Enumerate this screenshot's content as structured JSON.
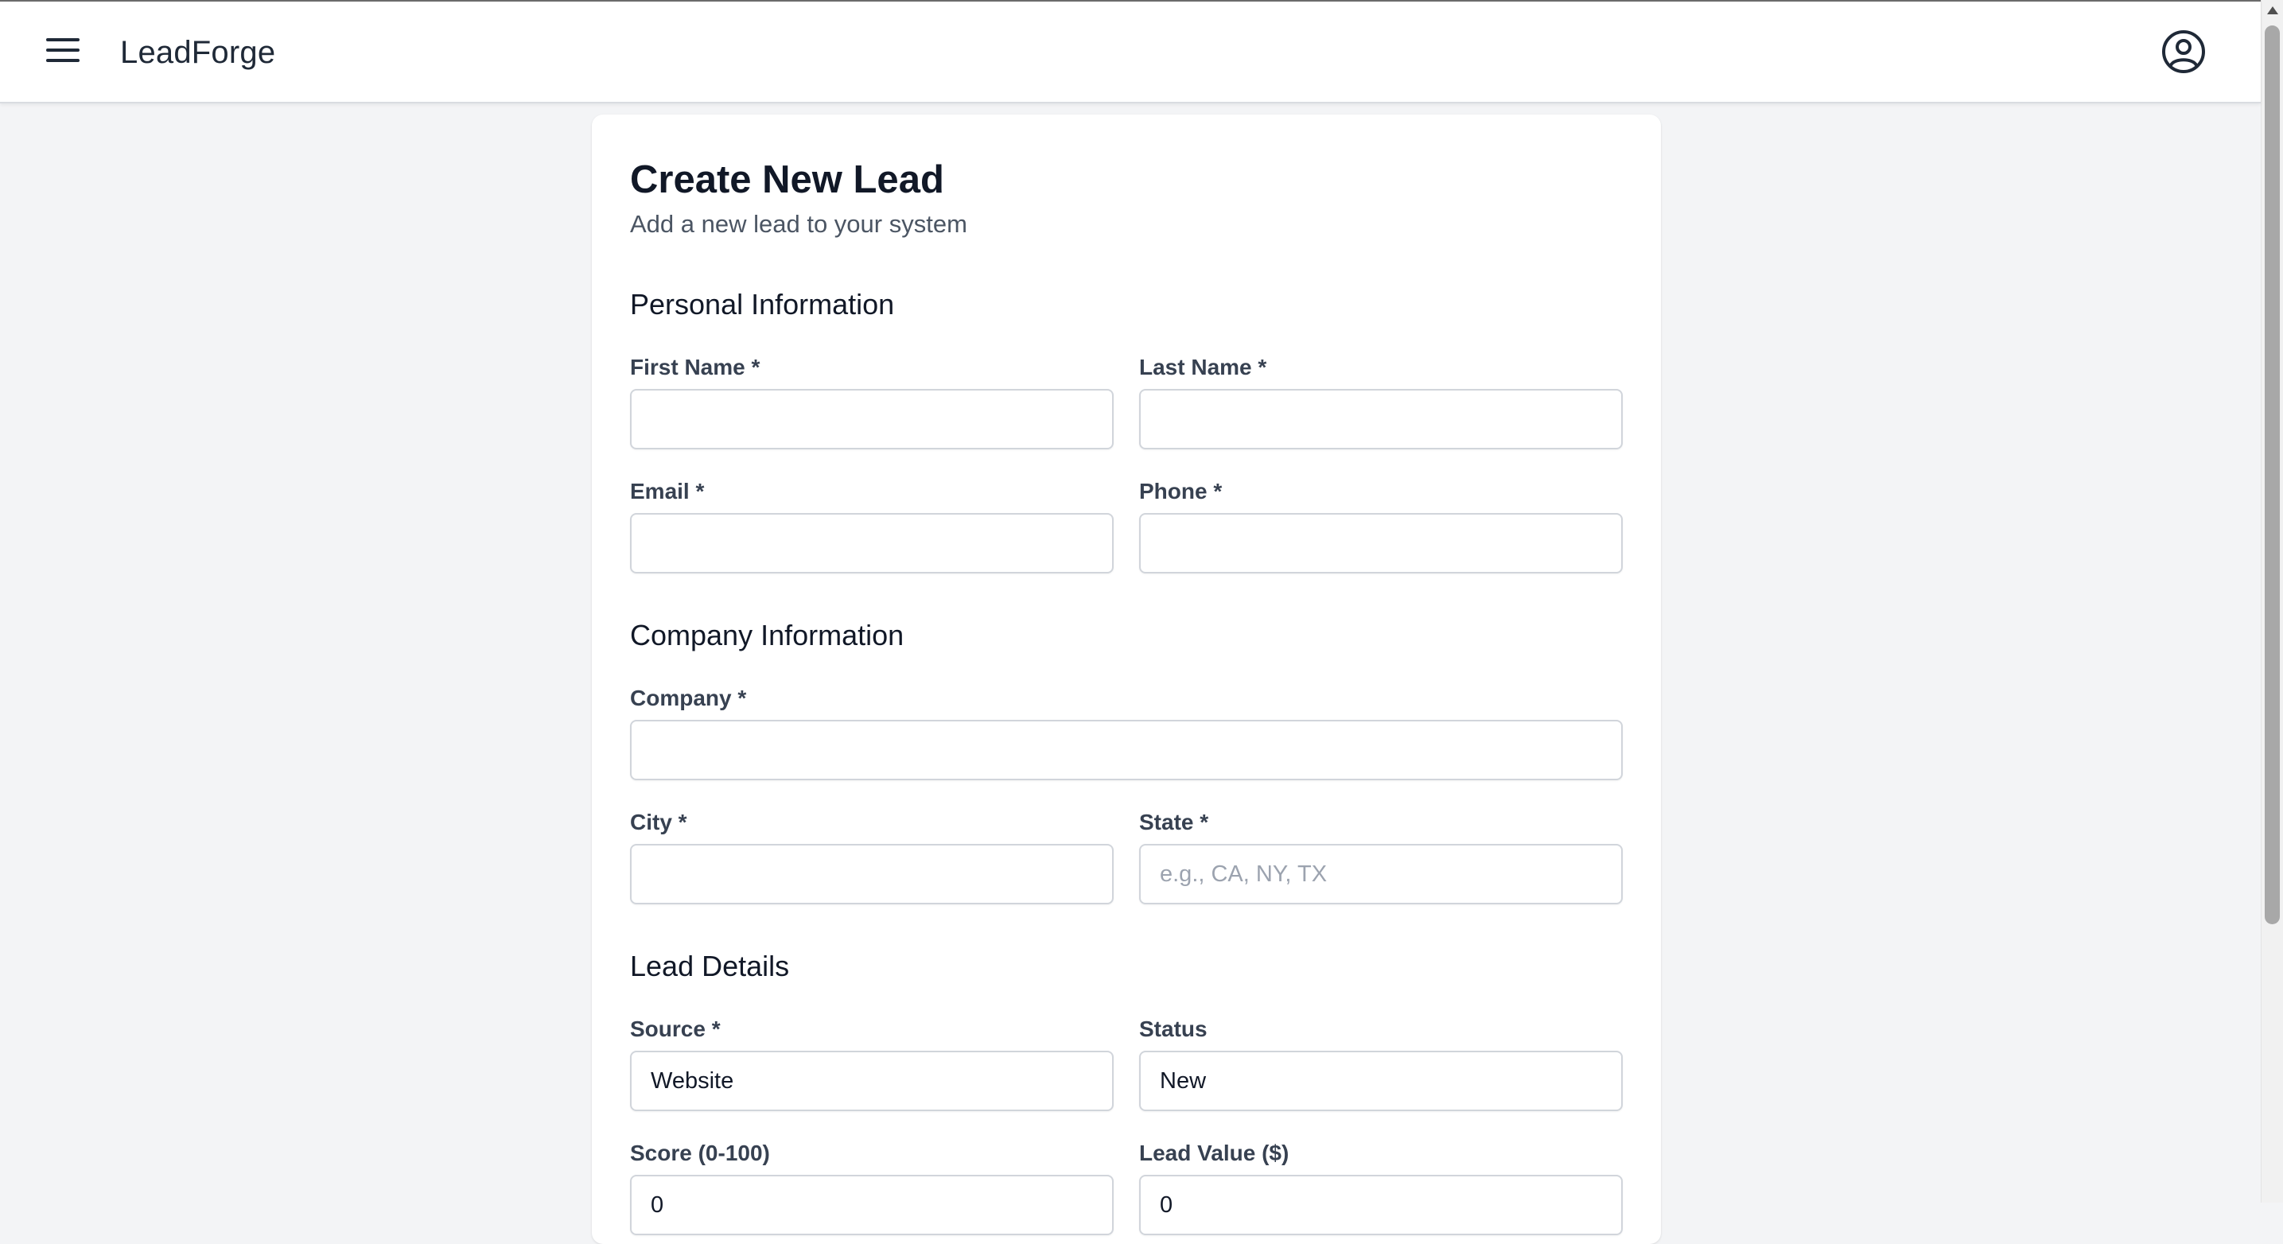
{
  "app": {
    "title": "LeadForge"
  },
  "header": {
    "menu_icon": "hamburger-menu-icon",
    "account_icon": "user-circle-icon"
  },
  "form": {
    "title": "Create New Lead",
    "subtitle": "Add a new lead to your system",
    "sections": {
      "personal": {
        "title": "Personal Information",
        "first_name": {
          "label": "First Name *",
          "value": "",
          "placeholder": ""
        },
        "last_name": {
          "label": "Last Name *",
          "value": "",
          "placeholder": ""
        },
        "email": {
          "label": "Email *",
          "value": "",
          "placeholder": ""
        },
        "phone": {
          "label": "Phone *",
          "value": "",
          "placeholder": ""
        }
      },
      "company": {
        "title": "Company Information",
        "company": {
          "label": "Company *",
          "value": "",
          "placeholder": ""
        },
        "city": {
          "label": "City *",
          "value": "",
          "placeholder": ""
        },
        "state": {
          "label": "State *",
          "value": "",
          "placeholder": "e.g., CA, NY, TX"
        }
      },
      "lead_details": {
        "title": "Lead Details",
        "source": {
          "label": "Source *",
          "value": "Website"
        },
        "status": {
          "label": "Status",
          "value": "New"
        },
        "score": {
          "label": "Score (0-100)",
          "value": "0"
        },
        "lead_value": {
          "label": "Lead Value ($)",
          "value": "0"
        }
      }
    }
  },
  "colors": {
    "background": "#f3f4f6",
    "card": "#ffffff",
    "input_border": "#d1d5db",
    "text_primary": "#111827",
    "text_secondary": "#4b5563"
  }
}
